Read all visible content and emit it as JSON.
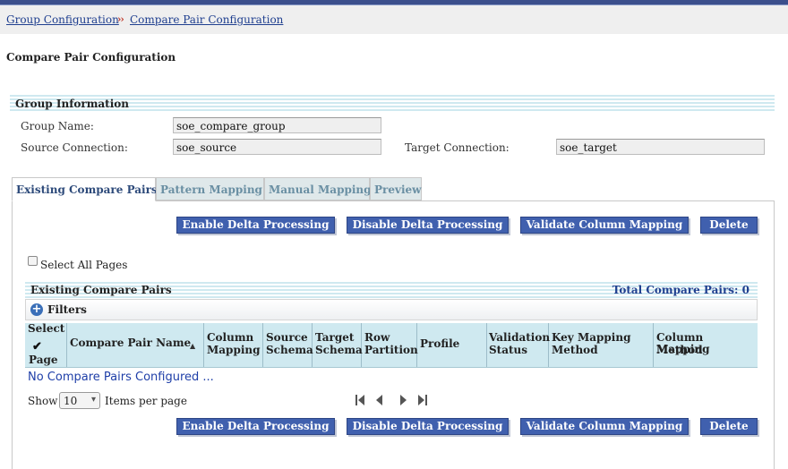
{
  "breadcrumb": {
    "items": [
      "Group Configuration",
      "Compare Pair Configuration"
    ],
    "separator": "››"
  },
  "page_title": "Compare Pair Configuration",
  "group_info": {
    "header": "Group Information",
    "group_name_label": "Group Name:",
    "group_name_value": "soe_compare_group",
    "source_label": "Source Connection:",
    "source_value": "soe_source",
    "target_label": "Target Connection:",
    "target_value": "soe_target"
  },
  "tabs": [
    {
      "label": "Existing Compare Pairs",
      "active": true
    },
    {
      "label": "Pattern Mapping",
      "active": false
    },
    {
      "label": "Manual Mapping",
      "active": false
    },
    {
      "label": "Preview",
      "active": false
    }
  ],
  "actions": {
    "enable": "Enable Delta Processing",
    "disable": "Disable Delta Processing",
    "validate": "Validate Column Mapping",
    "delete": "Delete"
  },
  "select_all_pages": "Select All Pages",
  "table": {
    "title": "Existing Compare Pairs",
    "total": "Total Compare Pairs: 0",
    "filters_label": "Filters",
    "columns": {
      "select_top": "Select",
      "select_bottom": "Page",
      "name": "Compare Pair Name",
      "col_map_1": "Column",
      "col_map_2": "Mapping",
      "src_schema_1": "Source",
      "src_schema_2": "Schema",
      "tgt_schema_1": "Target",
      "tgt_schema_2": "Schema",
      "row_part_1": "Row",
      "row_part_2": "Partition",
      "profile": "Profile",
      "validation_1": "Validation",
      "validation_2": "Status",
      "key_map_1": "Key Mapping",
      "key_map_2": "Method",
      "col_method_1": "Column Mapping",
      "col_method_2": "Method"
    },
    "empty_message": "No Compare Pairs Configured ...",
    "sort_indicator": "▲"
  },
  "pagination": {
    "show_label": "Show",
    "page_size": "10",
    "per_page_label": "Items per page"
  },
  "icons": {
    "first": "first-page-icon",
    "prev": "prev-page-icon",
    "next": "next-page-icon",
    "last": "last-page-icon",
    "add": "plus-circle-icon",
    "check": "checkmark-icon"
  },
  "colors": {
    "button_bg": "#4060ae",
    "header_stripe": "#cfe9f0",
    "link": "#1f3f8f"
  }
}
